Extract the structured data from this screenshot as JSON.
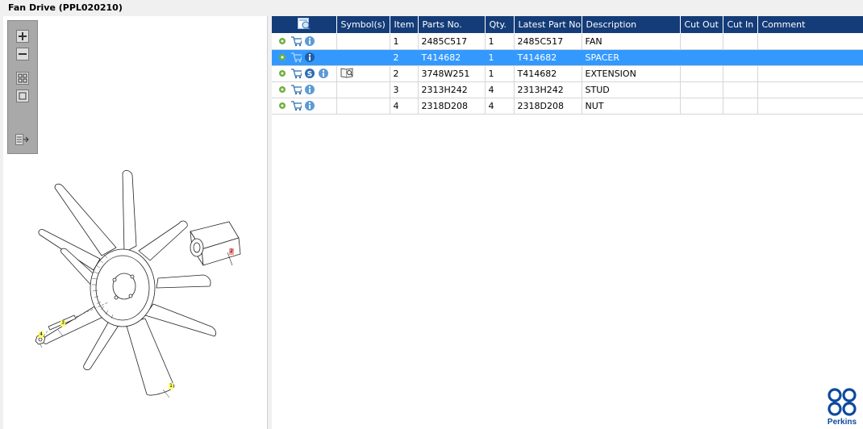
{
  "title": "Fan Drive (PPL020210)",
  "toolbar": {
    "buttons": [
      "zoom-in-icon",
      "zoom-out-icon",
      "fit-page-icon",
      "actual-size-icon",
      "export-icon"
    ]
  },
  "table": {
    "columns": [
      "",
      "Symbol(s)",
      "Item",
      "Parts No.",
      "Qty.",
      "Latest Part No.",
      "Description",
      "Cut Out",
      "Cut In",
      "Comment"
    ],
    "rows": [
      {
        "item": "1",
        "part_no": "2485C517",
        "qty": "1",
        "latest": "2485C517",
        "desc": "FAN",
        "cut_out": "",
        "cut_in": "",
        "comment": ""
      },
      {
        "item": "2",
        "part_no": "T414682",
        "qty": "1",
        "latest": "T414682",
        "desc": "SPACER",
        "cut_out": "",
        "cut_in": "",
        "comment": ""
      },
      {
        "item": "2",
        "part_no": "3748W251",
        "qty": "1",
        "latest": "T414682",
        "desc": "EXTENSION",
        "cut_out": "",
        "cut_in": "",
        "comment": ""
      },
      {
        "item": "3",
        "part_no": "2313H242",
        "qty": "4",
        "latest": "2313H242",
        "desc": "STUD",
        "cut_out": "",
        "cut_in": "",
        "comment": ""
      },
      {
        "item": "4",
        "part_no": "2318D208",
        "qty": "4",
        "latest": "2318D208",
        "desc": "NUT",
        "cut_out": "",
        "cut_in": "",
        "comment": ""
      }
    ]
  },
  "callouts": [
    "1",
    "2",
    "3",
    "4"
  ],
  "logo": {
    "text": "Perkins",
    "color": "#0d4a9e"
  },
  "colors": {
    "header": "#143c78",
    "selected": "#3399ff",
    "callout": "#ffff66",
    "callout_red": "#ff9999"
  }
}
